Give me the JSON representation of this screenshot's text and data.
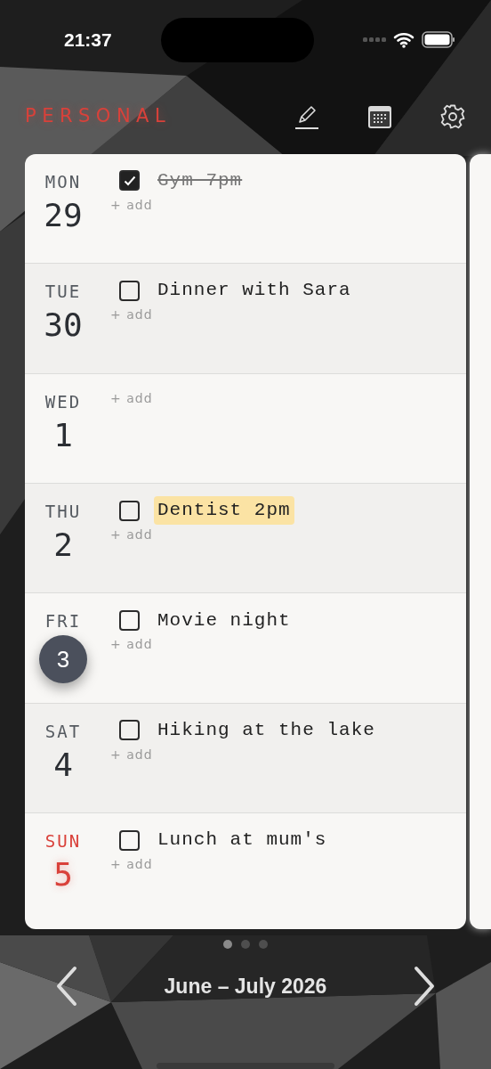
{
  "status_bar": {
    "time": "21:37"
  },
  "header": {
    "title": "PERSONAL"
  },
  "days": [
    {
      "weekday": "MON",
      "date": "29",
      "kind": "weekday",
      "today": false,
      "tasks": [
        {
          "text": "Gym 7pm",
          "checked": true,
          "highlighted": false
        }
      ],
      "add_label": "+ add"
    },
    {
      "weekday": "TUE",
      "date": "30",
      "kind": "weekday",
      "today": false,
      "tasks": [
        {
          "text": "Dinner with Sara",
          "checked": false,
          "highlighted": false
        }
      ],
      "add_label": "+ add"
    },
    {
      "weekday": "WED",
      "date": "1",
      "kind": "weekday",
      "today": false,
      "add_label": "+ add"
    },
    {
      "weekday": "THU",
      "date": "2",
      "kind": "weekday",
      "today": false,
      "tasks": [
        {
          "text": "Dentist 2pm",
          "checked": false,
          "highlighted": true
        }
      ],
      "add_label": "+ add"
    },
    {
      "weekday": "FRI",
      "date": "3",
      "kind": "weekday",
      "today": true,
      "tasks": [
        {
          "text": "Movie night",
          "checked": false,
          "highlighted": false
        }
      ],
      "add_label": "+ add"
    },
    {
      "weekday": "SAT",
      "date": "4",
      "kind": "weekday",
      "today": false,
      "tasks": [
        {
          "text": "Hiking at the lake",
          "checked": false,
          "highlighted": false
        }
      ],
      "add_label": "+ add"
    },
    {
      "weekday": "SUN",
      "date": "5",
      "kind": "sunday",
      "today": false,
      "tasks": [
        {
          "text": "Lunch at mum's",
          "checked": false,
          "highlighted": false
        }
      ],
      "add_label": "+ add"
    }
  ],
  "pages": [
    {
      "selected": true
    },
    {
      "selected": false
    },
    {
      "selected": false
    }
  ],
  "footer": {
    "range": "June – July 2026"
  }
}
